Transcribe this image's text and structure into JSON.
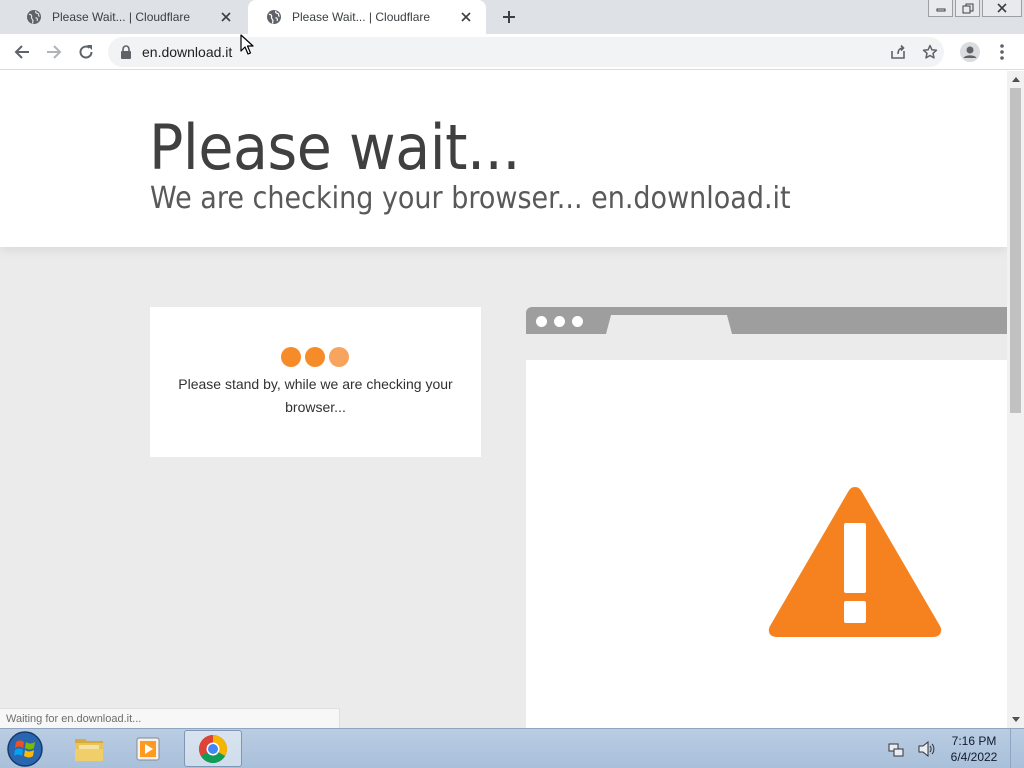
{
  "browser": {
    "tabs": [
      {
        "title": "Please Wait... | Cloudflare",
        "active": false
      },
      {
        "title": "Please Wait... | Cloudflare",
        "active": true
      }
    ],
    "url": "en.download.it",
    "status_text": "Waiting for en.download.it..."
  },
  "page": {
    "heading": "Please wait...",
    "subheading": "We are checking your browser... en.download.it",
    "card_text": "Please stand by, while we are checking your browser..."
  },
  "colors": {
    "accent_orange": "#f6821f",
    "dot_1": "#f68b2a",
    "dot_2": "#f68b2a",
    "dot_3": "#f7a45e"
  },
  "taskbar": {
    "apps": [
      "windows-start",
      "file-explorer",
      "media-player",
      "google-chrome"
    ],
    "clock_time": "7:16 PM",
    "clock_date": "6/4/2022"
  }
}
